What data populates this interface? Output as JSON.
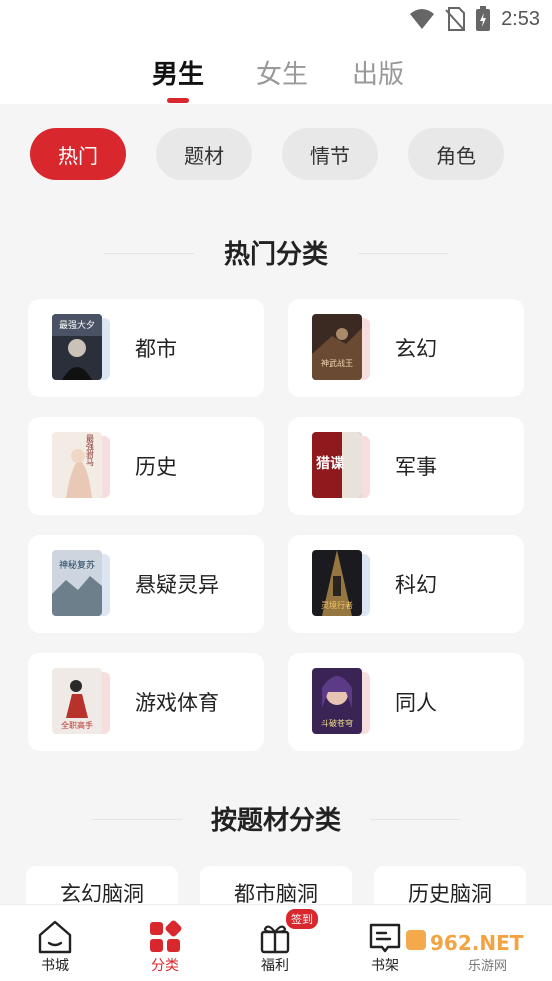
{
  "status_bar": {
    "time": "2:53"
  },
  "top_tabs": [
    {
      "label": "男生",
      "active": true
    },
    {
      "label": "女生",
      "active": false
    },
    {
      "label": "出版",
      "active": false
    }
  ],
  "chips": [
    {
      "label": "热门",
      "active": true
    },
    {
      "label": "题材",
      "active": false
    },
    {
      "label": "情节",
      "active": false
    },
    {
      "label": "角色",
      "active": false
    }
  ],
  "hot_section": {
    "title": "热门分类",
    "categories": [
      {
        "label": "都市",
        "cover_title": "最强大夕"
      },
      {
        "label": "玄幻",
        "cover_title": "神武战王"
      },
      {
        "label": "历史",
        "cover_title": "最强驸马"
      },
      {
        "label": "军事",
        "cover_title": "猎谍"
      },
      {
        "label": "悬疑灵异",
        "cover_title": "神秘复苏"
      },
      {
        "label": "科幻",
        "cover_title": "灵境行者"
      },
      {
        "label": "游戏体育",
        "cover_title": "全职高手"
      },
      {
        "label": "同人",
        "cover_title": "斗破苍穹"
      }
    ]
  },
  "theme_section": {
    "title": "按题材分类",
    "items": [
      "玄幻脑洞",
      "都市脑洞",
      "历史脑洞"
    ]
  },
  "bottom_nav": {
    "items": [
      {
        "label": "书城",
        "active": false
      },
      {
        "label": "分类",
        "active": true
      },
      {
        "label": "福利",
        "active": false,
        "badge": "签到"
      },
      {
        "label": "书架",
        "active": false
      }
    ]
  },
  "watermark": {
    "text": "962.NET",
    "sub": "乐游网"
  },
  "colors": {
    "accent": "#d8282d",
    "background": "#f5f5f5",
    "card": "#ffffff"
  }
}
